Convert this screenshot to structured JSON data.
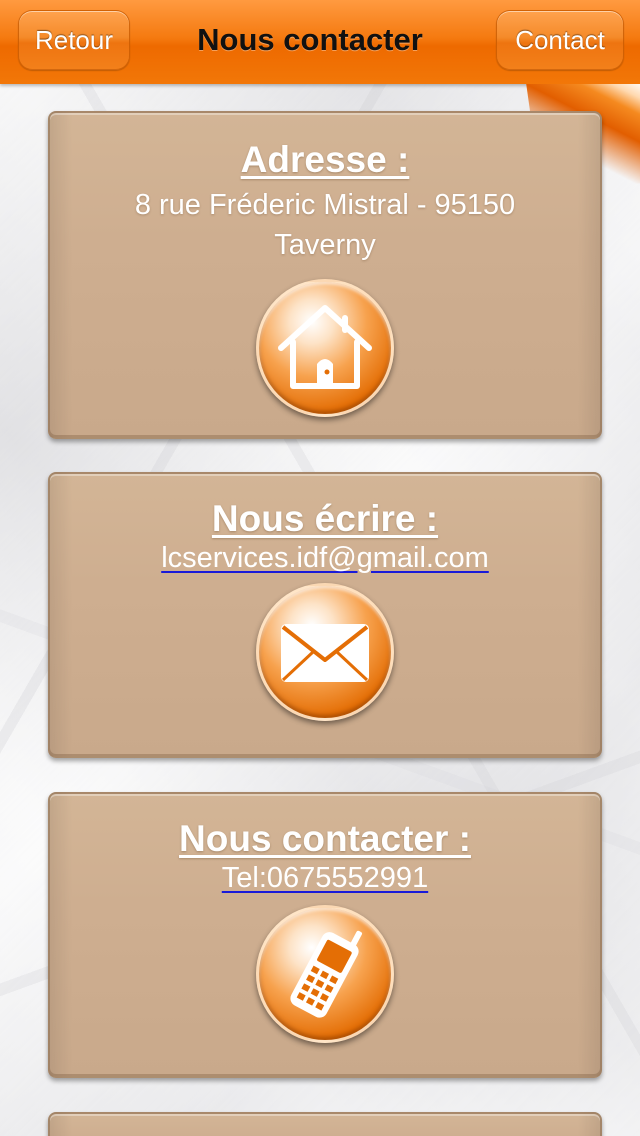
{
  "header": {
    "back_label": "Retour",
    "title": "Nous contacter",
    "contact_label": "Contact"
  },
  "cards": {
    "address": {
      "title": "Adresse :",
      "text": "8 rue Fréderic Mistral - 95150 Taverny",
      "icon": "home-icon"
    },
    "email": {
      "title": "Nous écrire :",
      "link": "lcservices.idf@gmail.com",
      "icon": "mail-icon"
    },
    "phone": {
      "title": "Nous contacter :",
      "link": "Tel:0675552991",
      "icon": "phone-icon"
    }
  },
  "colors": {
    "header_orange": "#f27708",
    "card_tan": "#ceae90",
    "link_underline": "#1a1ad8"
  }
}
